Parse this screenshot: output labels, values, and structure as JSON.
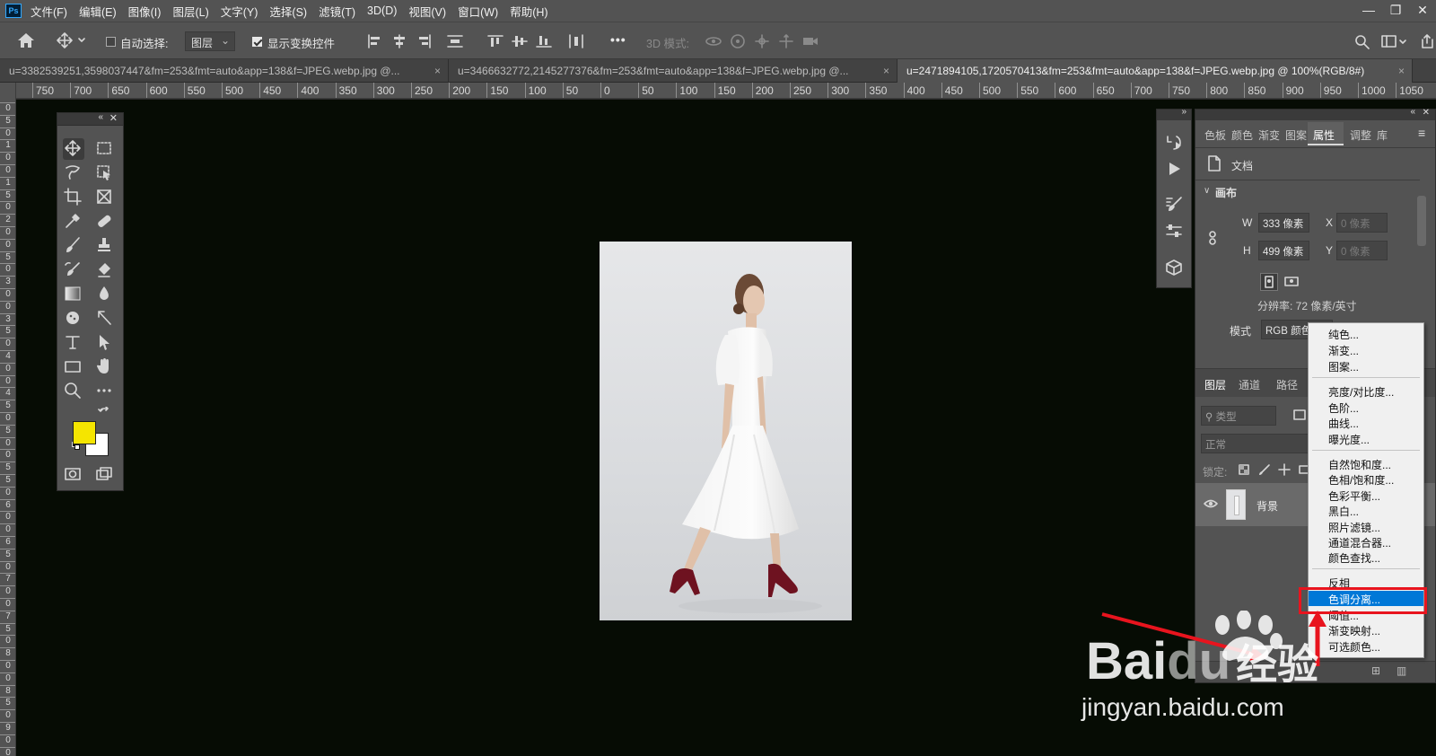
{
  "app": {
    "logo": "Ps"
  },
  "menubar": {
    "items": [
      "文件(F)",
      "编辑(E)",
      "图像(I)",
      "图层(L)",
      "文字(Y)",
      "选择(S)",
      "滤镜(T)",
      "3D(D)",
      "视图(V)",
      "窗口(W)",
      "帮助(H)"
    ]
  },
  "options": {
    "auto_select_label": "自动选择:",
    "auto_select_value": "图层",
    "show_transform_label": "显示变换控件",
    "mode_3d_label": "3D 模式:",
    "more": "•••"
  },
  "tabs": [
    {
      "title": "u=3382539251,3598037447&fm=253&fmt=auto&app=138&f=JPEG.webp.jpg @...",
      "close": "×"
    },
    {
      "title": "u=3466632772,2145277376&fm=253&fmt=auto&app=138&f=JPEG.webp.jpg @...",
      "close": "×"
    },
    {
      "title": "u=2471894105,1720570413&fm=253&fmt=auto&app=138&f=JPEG.webp.jpg @ 100%(RGB/8#)",
      "close": "×"
    }
  ],
  "ruler_h": [
    "750",
    "700",
    "650",
    "600",
    "550",
    "500",
    "450",
    "400",
    "350",
    "300",
    "250",
    "200",
    "150",
    "100",
    "50",
    "0",
    "50",
    "100",
    "150",
    "200",
    "250",
    "300",
    "350",
    "400",
    "450",
    "500",
    "550",
    "600",
    "650",
    "700",
    "750",
    "800",
    "850",
    "900",
    "950",
    "1000",
    "1050"
  ],
  "ruler_v": [
    "0",
    "5",
    "0",
    "1",
    "0",
    "0",
    "1",
    "5",
    "0",
    "2",
    "0",
    "0",
    "5",
    "0",
    "3",
    "0",
    "0",
    "3",
    "5",
    "0",
    "4",
    "0",
    "0",
    "4",
    "5",
    "0",
    "5",
    "0",
    "0",
    "5",
    "5",
    "0",
    "6",
    "0",
    "0",
    "6",
    "5",
    "0",
    "7",
    "0",
    "0",
    "7",
    "5",
    "0",
    "8",
    "0",
    "0",
    "8",
    "5",
    "0",
    "9",
    "0",
    "0"
  ],
  "colors": {
    "foreground": "#f5e500",
    "background": "#ffffff",
    "highlight": "#e8141e",
    "menu_selected": "#0078d7"
  },
  "properties": {
    "tabs": [
      "色板",
      "颜色",
      "渐变",
      "图案",
      "属性",
      "调整",
      "库"
    ],
    "doc_label": "文档",
    "section": "画布",
    "w_label": "W",
    "w_value": "333 像素",
    "h_label": "H",
    "h_value": "499 像素",
    "x_label": "X",
    "x_value": "0 像素",
    "y_label": "Y",
    "y_value": "0 像素",
    "resolution": "分辨率: 72 像素/英寸",
    "mode_label": "模式",
    "mode_value": "RGB 颜色"
  },
  "layers": {
    "tabs": [
      "图层",
      "通道",
      "路径"
    ],
    "search_placeholder": "类型",
    "blend_mode": "正常",
    "lock_label": "锁定:",
    "layer_name": "背景"
  },
  "adjust_menu": {
    "groups": [
      [
        "纯色...",
        "渐变...",
        "图案..."
      ],
      [
        "亮度/对比度...",
        "色阶...",
        "曲线...",
        "曝光度..."
      ],
      [
        "自然饱和度...",
        "色相/饱和度...",
        "色彩平衡...",
        "黑白...",
        "照片滤镜...",
        "通道混合器...",
        "颜色查找..."
      ],
      [
        "反相",
        "色调分离...",
        "阈值...",
        "渐变映射...",
        "可选颜色..."
      ]
    ],
    "selected": "色调分离..."
  },
  "watermark": {
    "brand": "Bai",
    "brand2": "du",
    "cn": "经验",
    "url": "jingyan.baidu.com"
  }
}
